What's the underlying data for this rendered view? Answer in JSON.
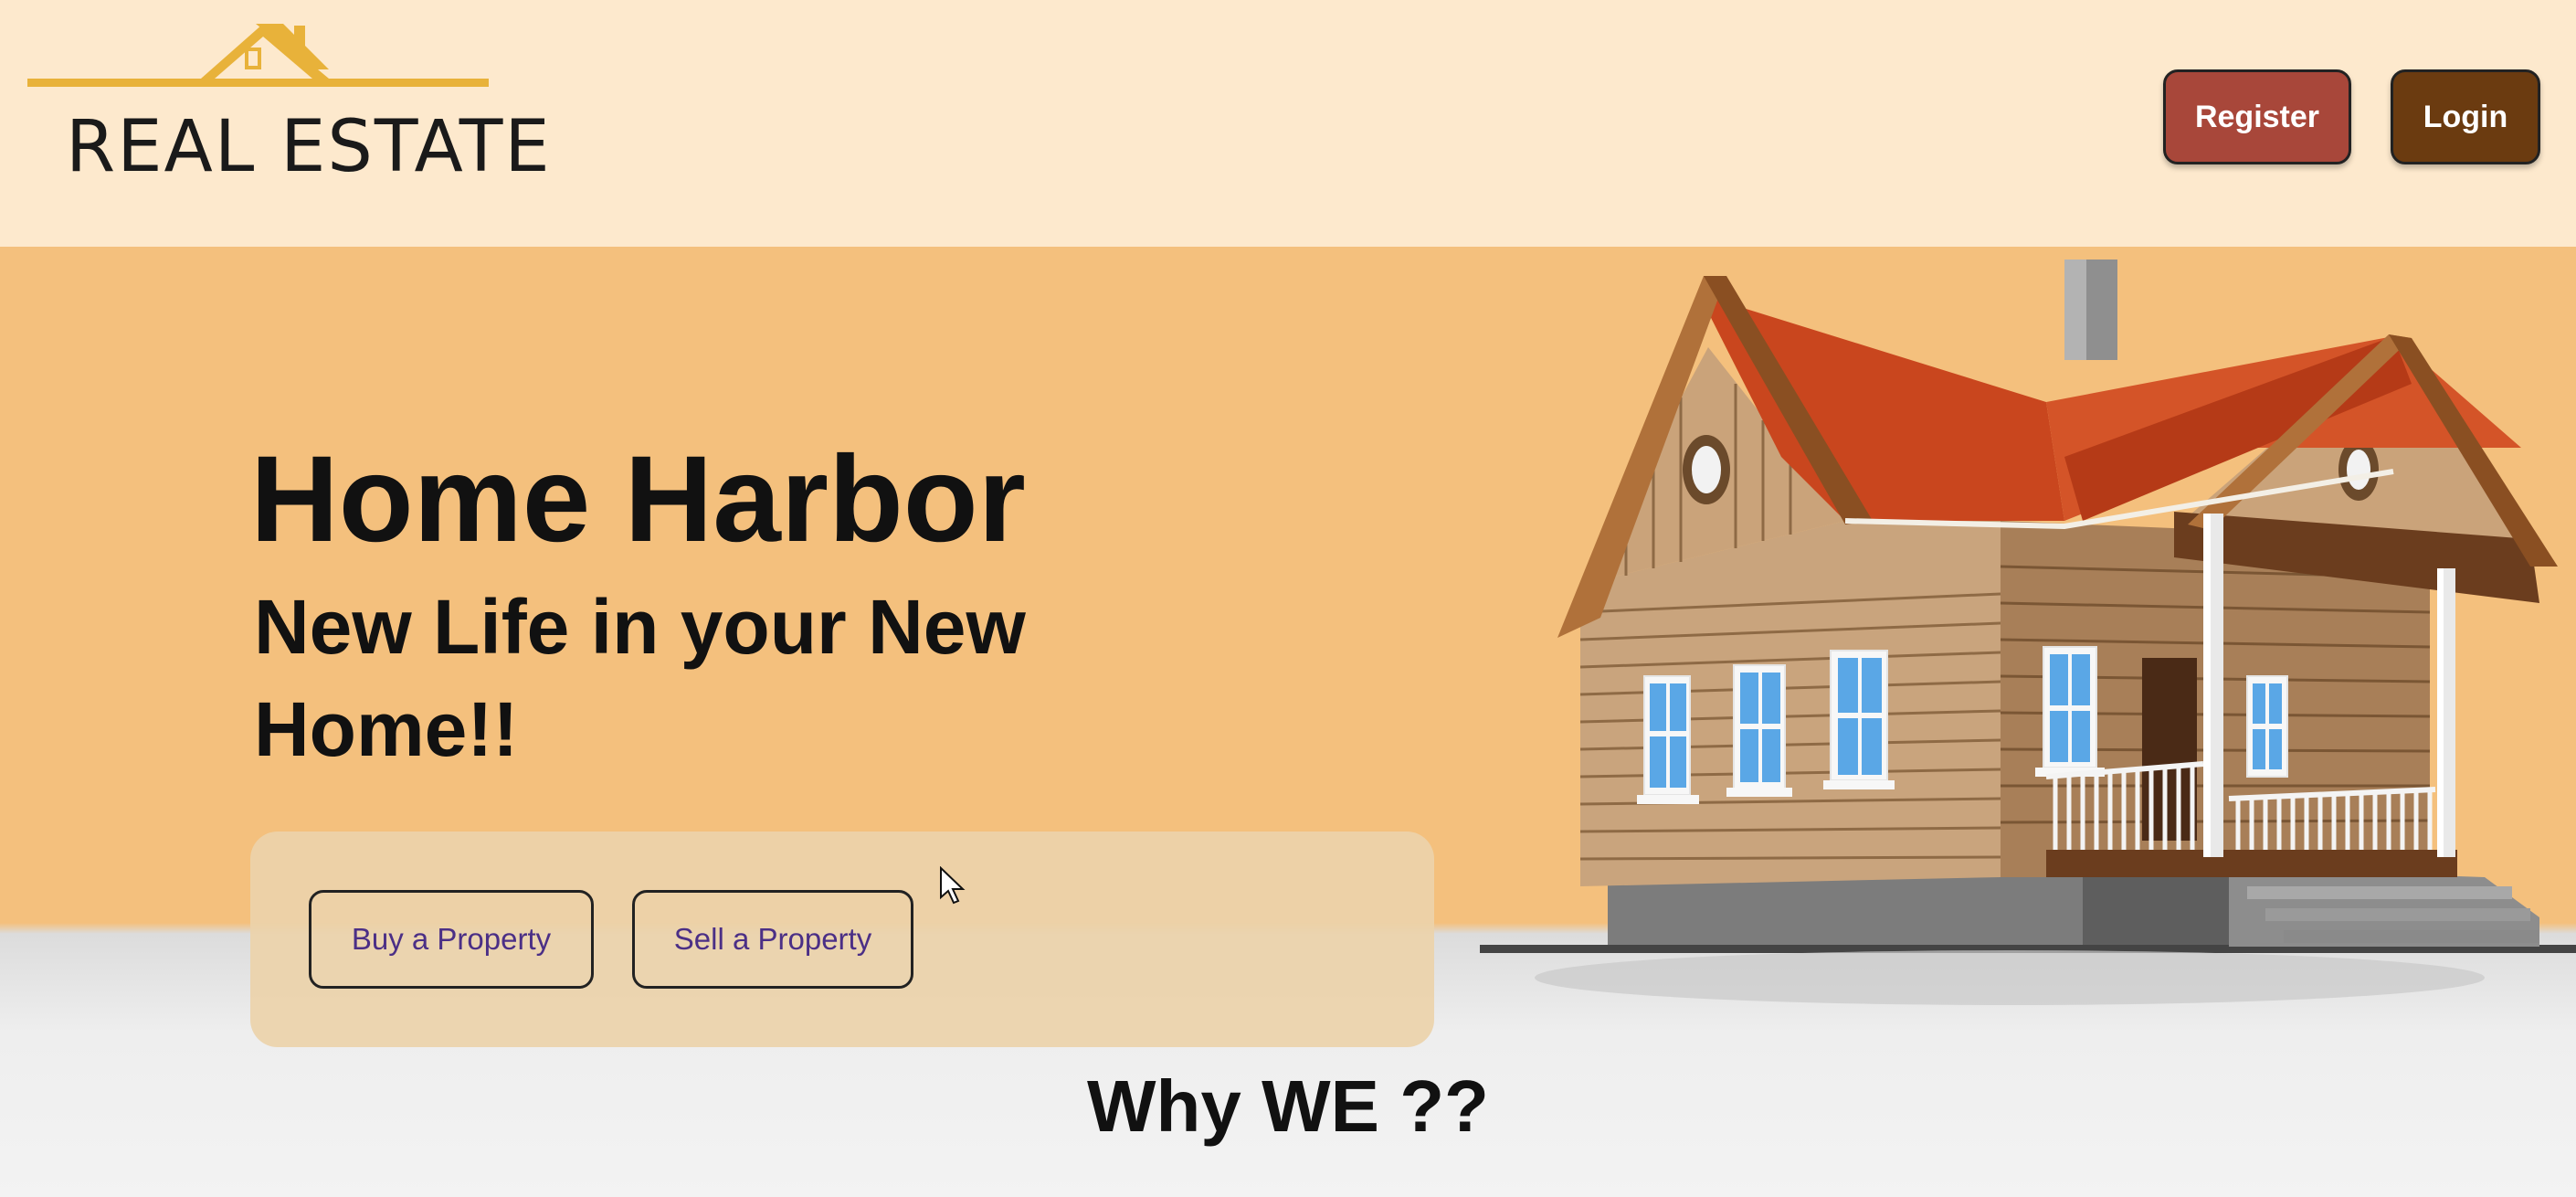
{
  "header": {
    "logo_text": "REAL ESTATE",
    "register_label": "Register",
    "login_label": "Login"
  },
  "hero": {
    "title": "Home Harbor",
    "tagline": "New Life in your New Home!!",
    "buy_label": "Buy a Property",
    "sell_label": "Sell a Property"
  },
  "section": {
    "heading": "Why WE ??"
  },
  "icons": [
    "house-logo-icon",
    "house-illustration",
    "cursor-icon"
  ],
  "colors": {
    "header_bg": "#fde9cd",
    "hero_bg": "#f4c07d",
    "register_bg": "#a8473a",
    "login_bg": "#6b3b10",
    "action_text": "#4b2f86",
    "logo_gold": "#e8b23a"
  }
}
